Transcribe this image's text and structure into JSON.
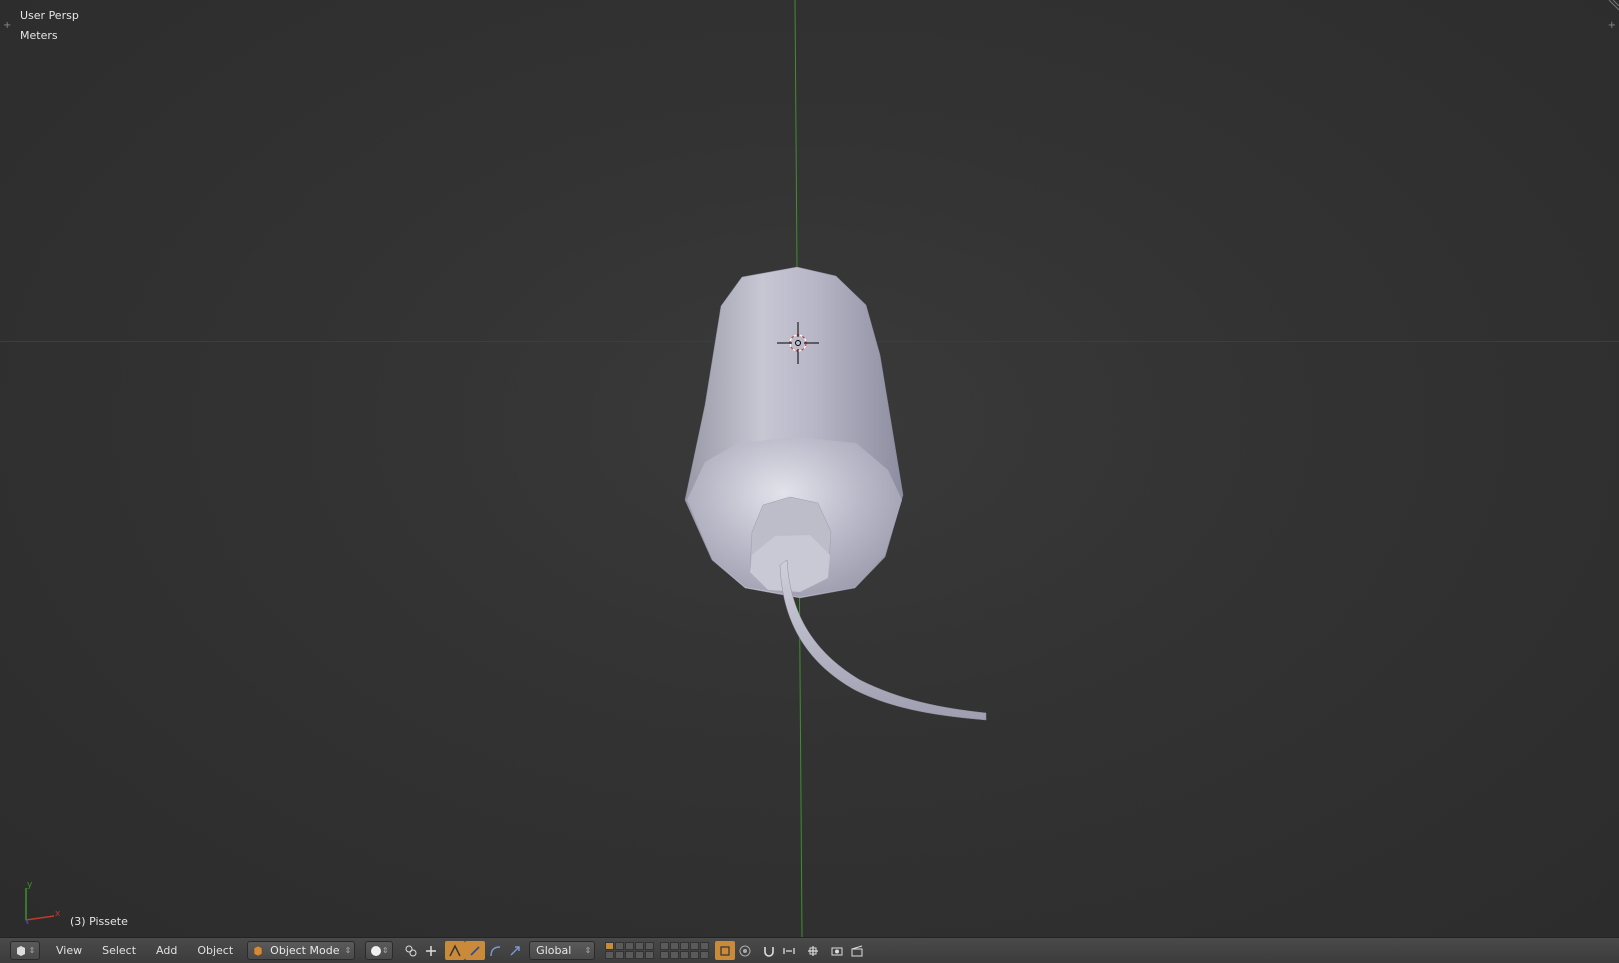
{
  "viewport": {
    "view_name": "User Persp",
    "units": "Meters",
    "object_info": "(3) Pissete",
    "axis_labels": {
      "y": "y",
      "x": "x"
    }
  },
  "header": {
    "menus": [
      "View",
      "Select",
      "Add",
      "Object"
    ],
    "mode": "Object Mode",
    "transform_orientation": "Global"
  },
  "colors": {
    "x_axis": "#a03a2a",
    "y_axis": "#3f8f2f",
    "active_button": "#c98a3a",
    "background": "#333333"
  },
  "icons": {
    "editor_type": "view3d-icon",
    "mode": "cube-icon",
    "shading": "solid-shading-icon",
    "pivot": "pivot-icon",
    "manipulator": "manipulator-icon",
    "translate": "translate-icon",
    "rotate": "rotate-icon",
    "scale": "scale-icon",
    "layers": "layers-grid",
    "lock": "lock-camera-icon",
    "proportional": "proportional-edit-icon",
    "snap": "magnet-icon",
    "snap_element": "snap-increment-icon",
    "render_preview": "render-icon",
    "render_anim": "clapperboard-icon"
  }
}
